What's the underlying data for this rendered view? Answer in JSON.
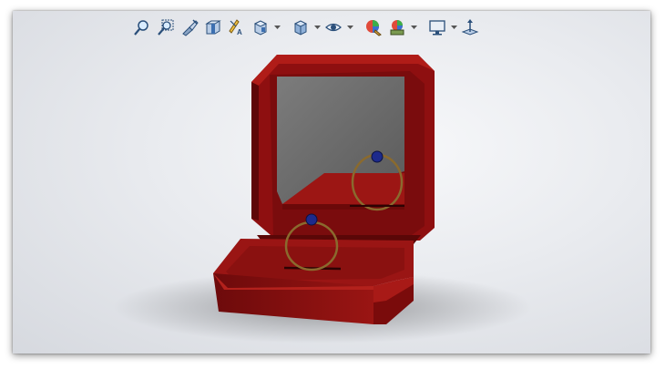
{
  "window": {
    "title": ""
  },
  "toolbar": {
    "buttons": [
      {
        "name": "zoom-to-fit-icon",
        "dropdown": false
      },
      {
        "name": "zoom-to-area-icon",
        "dropdown": false
      },
      {
        "name": "previous-view-icon",
        "dropdown": false
      },
      {
        "name": "section-view-icon",
        "dropdown": false
      },
      {
        "name": "dynamic-annotation-views-icon",
        "dropdown": false
      },
      {
        "name": "view-orientation-icon",
        "dropdown": true
      },
      {
        "name": "display-style-icon",
        "dropdown": true
      },
      {
        "name": "hide-show-items-icon",
        "dropdown": true
      },
      {
        "name": "edit-appearance-icon",
        "dropdown": false
      },
      {
        "name": "apply-scene-icon",
        "dropdown": true
      },
      {
        "name": "view-settings-icon",
        "dropdown": true
      },
      {
        "name": "rotate-view-icon",
        "dropdown": false
      }
    ]
  },
  "colors": {
    "box_red": "#8e0f10",
    "box_red_dark": "#5e0708",
    "box_red_light": "#a41a17",
    "mirror": "#6f6f6f",
    "ring_gold": "#8a6a2e",
    "gem_blue": "#1d2a8c",
    "accent": "#2a6fbd"
  }
}
